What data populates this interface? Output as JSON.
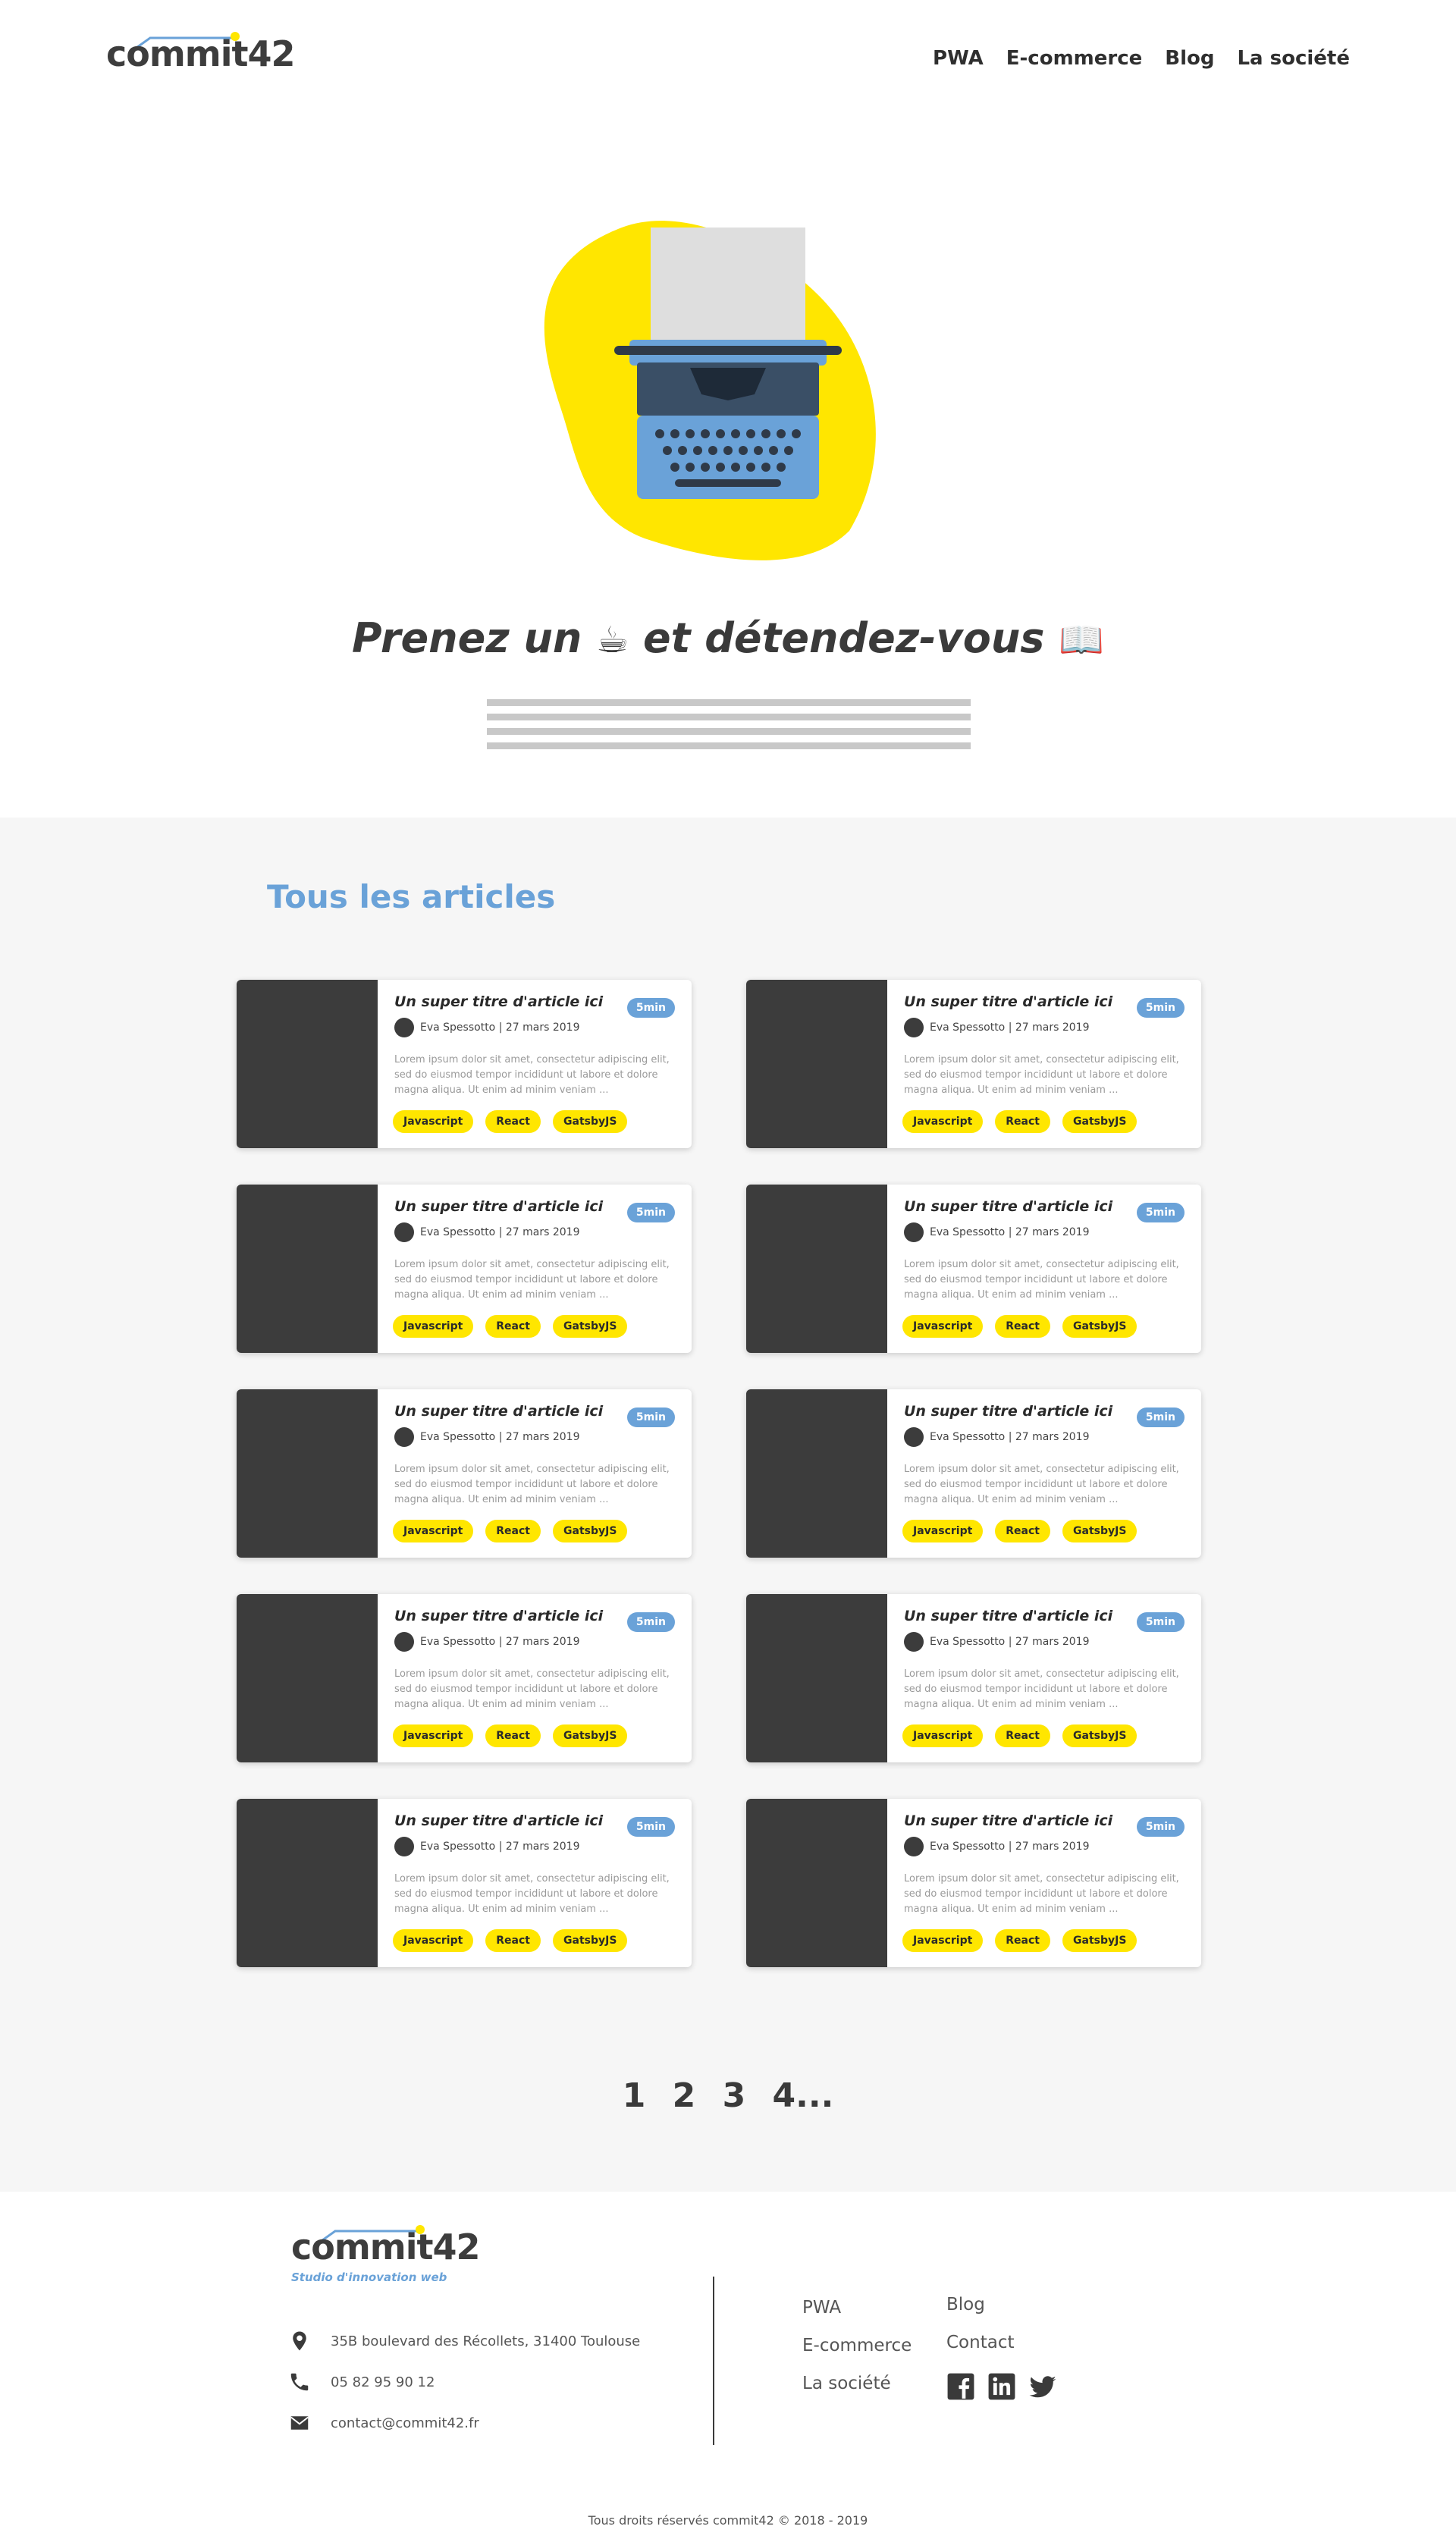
{
  "header": {
    "logo_text": "commit42",
    "nav": [
      "PWA",
      "E-commerce",
      "Blog",
      "La société"
    ]
  },
  "hero": {
    "title_part1": "Prenez un",
    "title_emoji1": "☕",
    "title_part2": "et détendez-vous",
    "title_emoji2": "📖"
  },
  "articles": {
    "section_title": "Tous les articles",
    "cards": [
      {
        "title": "Un super titre d'article ici",
        "read_time": "5min",
        "author_date": "Eva Spessotto | 27 mars 2019",
        "excerpt": "Lorem ipsum dolor sit amet, consectetur adipiscing elit, sed do eiusmod tempor incididunt ut labore et dolore magna aliqua. Ut enim ad minim veniam ...",
        "tags": [
          "Javascript",
          "React",
          "GatsbyJS"
        ]
      },
      {
        "title": "Un super titre d'article ici",
        "read_time": "5min",
        "author_date": "Eva Spessotto | 27 mars 2019",
        "excerpt": "Lorem ipsum dolor sit amet, consectetur adipiscing elit, sed do eiusmod tempor incididunt ut labore et dolore magna aliqua. Ut enim ad minim veniam ...",
        "tags": [
          "Javascript",
          "React",
          "GatsbyJS"
        ]
      },
      {
        "title": "Un super titre d'article ici",
        "read_time": "5min",
        "author_date": "Eva Spessotto | 27 mars 2019",
        "excerpt": "Lorem ipsum dolor sit amet, consectetur adipiscing elit, sed do eiusmod tempor incididunt ut labore et dolore magna aliqua. Ut enim ad minim veniam ...",
        "tags": [
          "Javascript",
          "React",
          "GatsbyJS"
        ]
      },
      {
        "title": "Un super titre d'article ici",
        "read_time": "5min",
        "author_date": "Eva Spessotto | 27 mars 2019",
        "excerpt": "Lorem ipsum dolor sit amet, consectetur adipiscing elit, sed do eiusmod tempor incididunt ut labore et dolore magna aliqua. Ut enim ad minim veniam ...",
        "tags": [
          "Javascript",
          "React",
          "GatsbyJS"
        ]
      },
      {
        "title": "Un super titre d'article ici",
        "read_time": "5min",
        "author_date": "Eva Spessotto | 27 mars 2019",
        "excerpt": "Lorem ipsum dolor sit amet, consectetur adipiscing elit, sed do eiusmod tempor incididunt ut labore et dolore magna aliqua. Ut enim ad minim veniam ...",
        "tags": [
          "Javascript",
          "React",
          "GatsbyJS"
        ]
      },
      {
        "title": "Un super titre d'article ici",
        "read_time": "5min",
        "author_date": "Eva Spessotto | 27 mars 2019",
        "excerpt": "Lorem ipsum dolor sit amet, consectetur adipiscing elit, sed do eiusmod tempor incididunt ut labore et dolore magna aliqua. Ut enim ad minim veniam ...",
        "tags": [
          "Javascript",
          "React",
          "GatsbyJS"
        ]
      },
      {
        "title": "Un super titre d'article ici",
        "read_time": "5min",
        "author_date": "Eva Spessotto | 27 mars 2019",
        "excerpt": "Lorem ipsum dolor sit amet, consectetur adipiscing elit, sed do eiusmod tempor incididunt ut labore et dolore magna aliqua. Ut enim ad minim veniam ...",
        "tags": [
          "Javascript",
          "React",
          "GatsbyJS"
        ]
      },
      {
        "title": "Un super titre d'article ici",
        "read_time": "5min",
        "author_date": "Eva Spessotto | 27 mars 2019",
        "excerpt": "Lorem ipsum dolor sit amet, consectetur adipiscing elit, sed do eiusmod tempor incididunt ut labore et dolore magna aliqua. Ut enim ad minim veniam ...",
        "tags": [
          "Javascript",
          "React",
          "GatsbyJS"
        ]
      },
      {
        "title": "Un super titre d'article ici",
        "read_time": "5min",
        "author_date": "Eva Spessotto | 27 mars 2019",
        "excerpt": "Lorem ipsum dolor sit amet, consectetur adipiscing elit, sed do eiusmod tempor incididunt ut labore et dolore magna aliqua. Ut enim ad minim veniam ...",
        "tags": [
          "Javascript",
          "React",
          "GatsbyJS"
        ]
      },
      {
        "title": "Un super titre d'article ici",
        "read_time": "5min",
        "author_date": "Eva Spessotto | 27 mars 2019",
        "excerpt": "Lorem ipsum dolor sit amet, consectetur adipiscing elit, sed do eiusmod tempor incididunt ut labore et dolore magna aliqua. Ut enim ad minim veniam ...",
        "tags": [
          "Javascript",
          "React",
          "GatsbyJS"
        ]
      }
    ],
    "pagination": [
      "1",
      "2",
      "3",
      "4..."
    ]
  },
  "footer": {
    "logo_text": "commit42",
    "tagline": "Studio d'innovation web",
    "address": "35B boulevard des Récollets, 31400 Toulouse",
    "phone": "05 82 95 90 12",
    "email": "contact@commit42.fr",
    "links_col1": [
      "PWA",
      "E-commerce",
      "La société"
    ],
    "links_col2": [
      "Blog",
      "Contact"
    ],
    "social_icons": [
      "facebook-icon",
      "linkedin-icon",
      "twitter-icon"
    ],
    "copyright": "Tous droits réservés commit42 © 2018 - 2019"
  },
  "colors": {
    "accent_yellow": "#ffe600",
    "accent_blue": "#6aa2d8",
    "dark": "#3c3c3c",
    "section_bg": "#f6f6f6"
  }
}
